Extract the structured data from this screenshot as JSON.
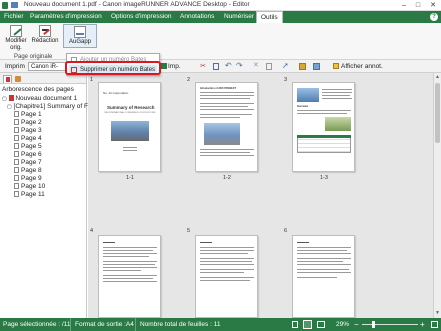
{
  "window": {
    "title": "Nouveau document 1.pdf - Canon imageRUNNER ADVANCE Desktop - Editor",
    "minimize_glyph": "–",
    "maximize_glyph": "□",
    "close_glyph": "✕"
  },
  "menubar": {
    "items": [
      {
        "label": "Fichier"
      },
      {
        "label": "Paramètres d'impression"
      },
      {
        "label": "Options d'impression"
      },
      {
        "label": "Annotations"
      },
      {
        "label": "Numériser"
      },
      {
        "label": "Outils"
      }
    ],
    "active_index": 5,
    "help_glyph": "?"
  },
  "ribbon": {
    "buttons": [
      {
        "label_line1": "Modifier",
        "label_line2": "orig."
      },
      {
        "label_line1": "Rédaction",
        "label_line2": ""
      },
      {
        "label_line1": "AuGapp",
        "label_line2": ""
      }
    ],
    "group_label": "Page originale"
  },
  "dropdown": {
    "items": [
      {
        "label": "Ajouter un numéro Bates"
      },
      {
        "label": "Supprimer un numéro Bates"
      }
    ]
  },
  "docbar": {
    "printer_label": "Imprim",
    "printer_value": "Canon iR-ADV",
    "print_button": "Imp.",
    "show_annotations": "Afficher annot."
  },
  "leftpane": {
    "header": "Arborescence des pages",
    "root": "Nouveau document 1",
    "chapter": "[Chapitre1] Summary of F",
    "pages": [
      "Page 1",
      "Page 2",
      "Page 3",
      "Page 4",
      "Page 5",
      "Page 6",
      "Page 7",
      "Page 8",
      "Page 9",
      "Page 10",
      "Page 11"
    ]
  },
  "pages": {
    "row1": [
      {
        "num": "1",
        "label": "1-1",
        "heading": "Summary of Research",
        "sub": "THE INTERNATIONAL CONFERENCE ON STRUCTURE",
        "corner": "No. 12 Corporation"
      },
      {
        "num": "2",
        "label": "1-2",
        "heading": "Introduction of ABC PROJECT"
      },
      {
        "num": "3",
        "label": "1-3",
        "heading": "Overview"
      }
    ],
    "row2": [
      {
        "num": "4"
      },
      {
        "num": "5"
      },
      {
        "num": "6"
      }
    ]
  },
  "statusbar": {
    "selected_pages": "Page sélectionnée : /11",
    "output_format": "Format de sortie :A4",
    "sheet_count": "Nombre total de feuilles : 11",
    "zoom": "29%"
  },
  "colors": {
    "accent": "#2a7a46",
    "highlight": "#e0141e"
  }
}
